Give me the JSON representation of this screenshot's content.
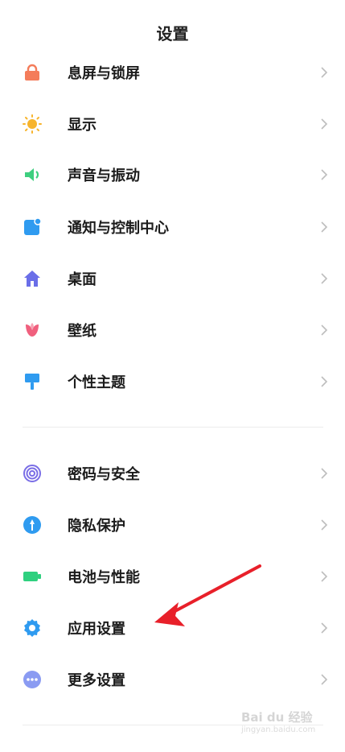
{
  "header": {
    "title": "设置"
  },
  "group1": [
    {
      "label": "息屏与锁屏",
      "icon": "lock-icon",
      "color": "#f47c5a"
    },
    {
      "label": "显示",
      "icon": "sun-icon",
      "color": "#f7b42c"
    },
    {
      "label": "声音与振动",
      "icon": "speaker-icon",
      "color": "#3ecf7f"
    },
    {
      "label": "通知与控制中心",
      "icon": "notification-icon",
      "color": "#2f9bf0"
    },
    {
      "label": "桌面",
      "icon": "home-icon",
      "color": "#6a6ee8"
    },
    {
      "label": "壁纸",
      "icon": "tulip-icon",
      "color": "#f0607e"
    },
    {
      "label": "个性主题",
      "icon": "brush-icon",
      "color": "#2f9bf0"
    }
  ],
  "group2": [
    {
      "label": "密码与安全",
      "icon": "fingerprint-icon",
      "color": "#7a6ee6"
    },
    {
      "label": "隐私保护",
      "icon": "privacy-shield-icon",
      "color": "#2f9bf0"
    },
    {
      "label": "电池与性能",
      "icon": "battery-icon",
      "color": "#2fd07f"
    },
    {
      "label": "应用设置",
      "icon": "gear-icon",
      "color": "#2f9bf0"
    },
    {
      "label": "更多设置",
      "icon": "more-dots-icon",
      "color": "#8a9bf2"
    }
  ],
  "watermark": {
    "text": "Bai du 经验",
    "sub": "jingyan.baidu.com"
  }
}
